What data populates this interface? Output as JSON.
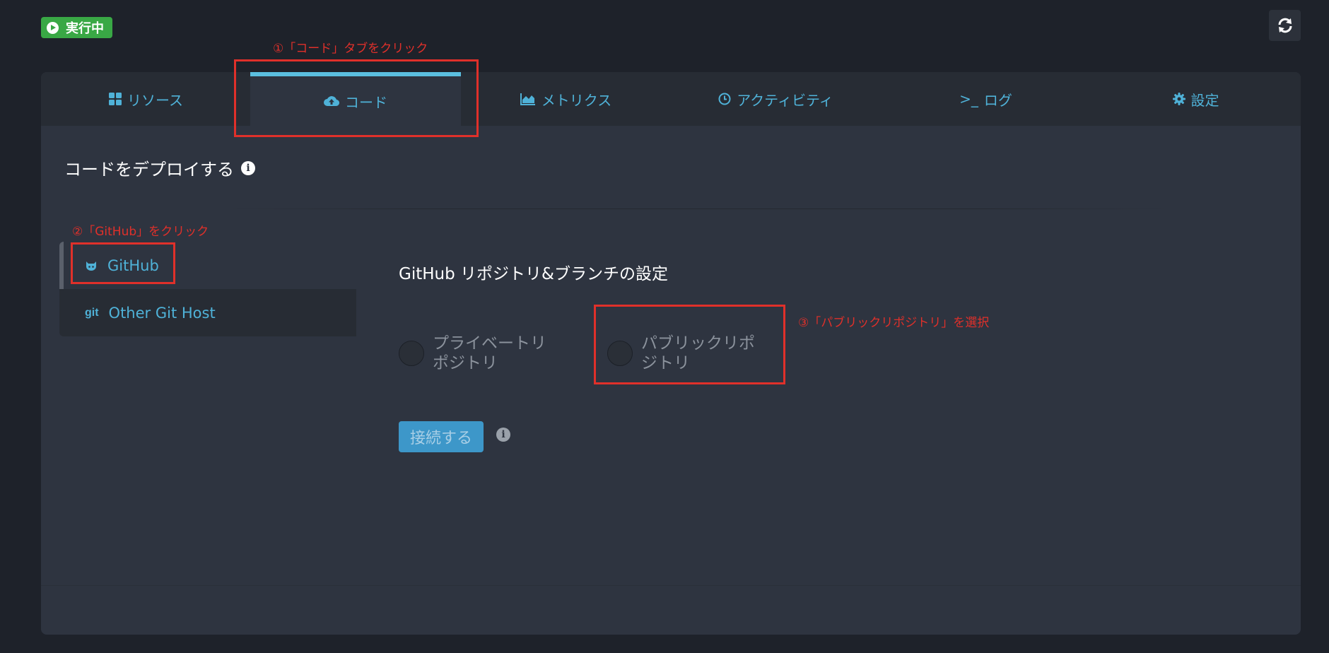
{
  "status": {
    "label": "実行中",
    "color": "#39a845"
  },
  "header": {
    "refresh_icon": "refresh-icon"
  },
  "tabs": [
    {
      "label": "リソース",
      "icon": "grid-icon"
    },
    {
      "label": "コード",
      "icon": "cloud-upload-icon",
      "active": true
    },
    {
      "label": "メトリクス",
      "icon": "area-chart-icon"
    },
    {
      "label": "アクティビティ",
      "icon": "clock-icon"
    },
    {
      "label": "ログ",
      "icon_text": ">_",
      "icon": "terminal-icon"
    },
    {
      "label": "設定",
      "icon": "gear-icon"
    }
  ],
  "section": {
    "title": "コードをデプロイする",
    "info_glyph": "i"
  },
  "providers": [
    {
      "label": "GitHub",
      "icon": "github-icon",
      "active": true
    },
    {
      "label": "Other Git Host",
      "icon_text": "git",
      "icon": "git-icon"
    }
  ],
  "form": {
    "title": "GitHub リポジトリ&ブランチの設定",
    "options": [
      {
        "label": "プライベートリポジトリ",
        "selected": false
      },
      {
        "label": "パブリックリポジトリ",
        "selected": false
      }
    ],
    "connect_label": "接続する",
    "info_glyph": "i"
  },
  "annotations": {
    "step1": "①「コード」タブをクリック",
    "step2": "②「GitHub」をクリック",
    "step3": "③「パブリックリポジトリ」を選択"
  },
  "colors": {
    "accent": "#4fb2d8",
    "annotation": "#e0302a",
    "button": "#3d97c9"
  }
}
